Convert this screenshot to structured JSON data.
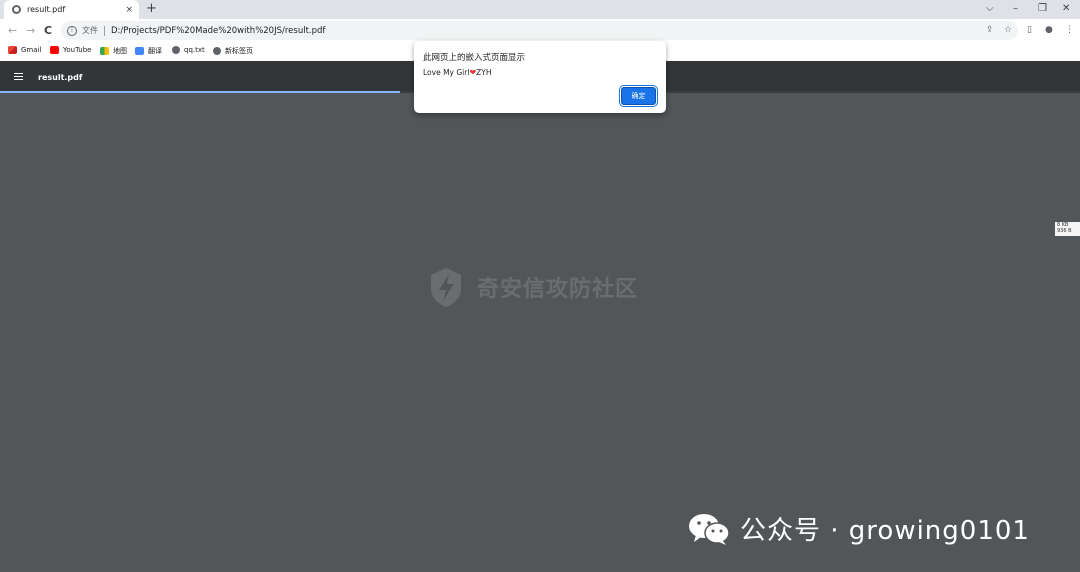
{
  "tab": {
    "title": "result.pdf",
    "close": "×",
    "new_tab": "+"
  },
  "window_controls": {
    "menu": "⌵",
    "minimize": "–",
    "restore": "❐",
    "close": "✕"
  },
  "nav": {
    "back": "←",
    "forward": "→",
    "reload": "C"
  },
  "omnibox": {
    "info": "i",
    "label": "文件",
    "url": "D:/Projects/PDF%20Made%20with%20JS/result.pdf"
  },
  "toolbar_right": {
    "share": "⇪",
    "star": "☆",
    "sidepanel": "▯",
    "profile": "●",
    "menu": "⋮"
  },
  "bookmarks": [
    {
      "label": "Gmail",
      "icon": "gmail-icon"
    },
    {
      "label": "YouTube",
      "icon": "youtube-icon"
    },
    {
      "label": "地图",
      "icon": "maps-icon"
    },
    {
      "label": "翻译",
      "icon": "translate-icon"
    },
    {
      "label": "qq.txt",
      "icon": "globe-icon"
    },
    {
      "label": "新标签页",
      "icon": "globe-icon"
    }
  ],
  "viewer": {
    "title": "result.pdf",
    "progress": 0.37
  },
  "dialog": {
    "title": "此网页上的嵌入式页面显示",
    "message_pre": "Love My Girl",
    "heart": "❤",
    "message_post": "ZYH",
    "ok_label": "确定"
  },
  "watermark": {
    "text": "奇安信攻防社区"
  },
  "side_badge": {
    "line1": "8 KB",
    "line2": "936 B"
  },
  "wechat": {
    "text": "公众号 · growing0101"
  },
  "colors": {
    "accent": "#1a73e8",
    "heart": "#e53935",
    "viewer_bg": "#525659",
    "viewer_bar": "#323639",
    "progress": "#8ab4f8"
  }
}
